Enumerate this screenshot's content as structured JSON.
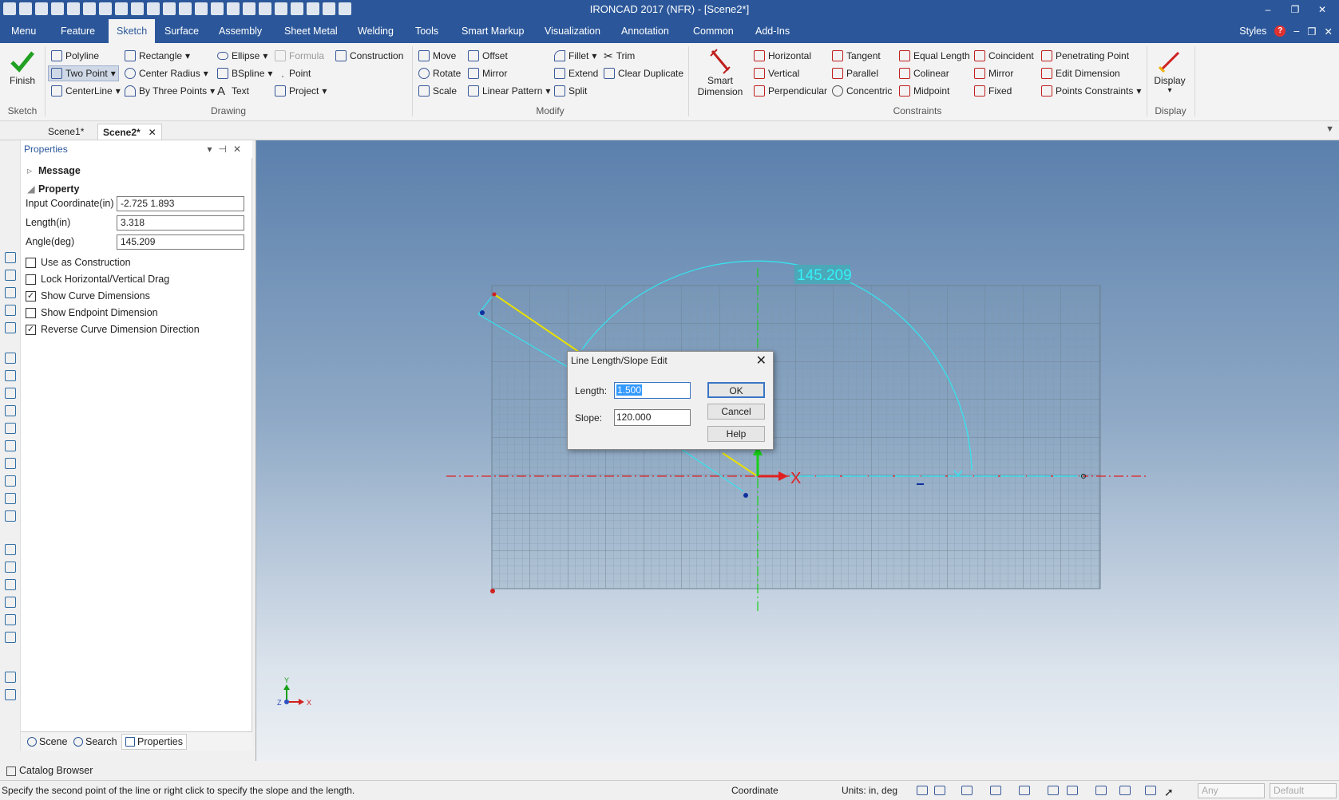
{
  "window": {
    "title": "IRONCAD 2017 (NFR) - [Scene2*]",
    "controls": [
      "‒",
      "❐",
      "✕"
    ]
  },
  "menubar": {
    "tabs": [
      "Menu",
      "Feature",
      "Sketch",
      "Surface",
      "Assembly",
      "Sheet Metal",
      "Welding",
      "Tools",
      "Smart Markup",
      "Visualization",
      "Annotation",
      "Common",
      "Add-Ins"
    ],
    "active": "Sketch",
    "right": {
      "styles": "Styles",
      "help_icon": "?",
      "controls": [
        "‒",
        "❐",
        "✕"
      ]
    }
  },
  "ribbon": {
    "sketch": {
      "finish": "Finish",
      "label": "Sketch"
    },
    "drawing": {
      "label": "Drawing",
      "items": [
        "Polyline",
        "Two Point",
        "CenterLine",
        "Rectangle",
        "Center Radius",
        "By Three Points",
        "Ellipse",
        "BSpline",
        "Text",
        "Formula",
        "Point",
        "Project",
        "Construction"
      ]
    },
    "modify": {
      "label": "Modify",
      "items": [
        "Move",
        "Rotate",
        "Scale",
        "Offset",
        "Mirror",
        "Linear Pattern",
        "Fillet",
        "Extend",
        "Split",
        "Trim",
        "Clear Duplicate"
      ]
    },
    "constraints": {
      "label": "Constraints",
      "smart_dimension": [
        "Smart",
        "Dimension"
      ],
      "items": [
        "Horizontal",
        "Vertical",
        "Perpendicular",
        "Tangent",
        "Parallel",
        "Concentric",
        "Equal Length",
        "Colinear",
        "Midpoint",
        "Coincident",
        "Mirror",
        "Fixed",
        "Penetrating Point",
        "Edit Dimension",
        "Points Constraints"
      ]
    },
    "display": {
      "button": "Display",
      "label": "Display"
    }
  },
  "doc_tabs": [
    "Scene1*",
    "Scene2*"
  ],
  "properties": {
    "title": "Properties",
    "sections": {
      "message": "Message",
      "property": "Property"
    },
    "fields": [
      {
        "label": "Input Coordinate(in)",
        "value": "-2.725 1.893"
      },
      {
        "label": "Length(in)",
        "value": "3.318"
      },
      {
        "label": "Angle(deg)",
        "value": "145.209"
      }
    ],
    "checkboxes": [
      {
        "label": "Use as Construction",
        "checked": false
      },
      {
        "label": "Lock Horizontal/Vertical Drag",
        "checked": false
      },
      {
        "label": "Show Curve Dimensions",
        "checked": true
      },
      {
        "label": "Show Endpoint Dimension",
        "checked": false
      },
      {
        "label": "Reverse Curve Dimension Direction",
        "checked": true
      }
    ],
    "bottom_tabs": [
      "Scene",
      "Search",
      "Properties"
    ]
  },
  "catalog": "Catalog Browser",
  "viewport": {
    "angle_label": "145.209",
    "axis_x": "X",
    "triad": {
      "y": "Y",
      "z": "Z",
      "x": "X"
    }
  },
  "dialog": {
    "title": "Line Length/Slope Edit",
    "length_label": "Length:",
    "length_value": "1.500",
    "slope_label": "Slope:",
    "slope_value": "120.000",
    "ok": "OK",
    "cancel": "Cancel",
    "help": "Help"
  },
  "statusbar": {
    "message": "Specify the second point of the line or right click to specify the slope and the length.",
    "coordinate": "Coordinate",
    "units": "Units: in, deg",
    "combo1": "Any",
    "combo2": "Default"
  },
  "colors": {
    "titlebar": "#2b579a",
    "sketch_cyan": "#35e3ee",
    "sketch_yellow": "#e8e000",
    "axis_red": "#e02020",
    "axis_green": "#18d018"
  }
}
